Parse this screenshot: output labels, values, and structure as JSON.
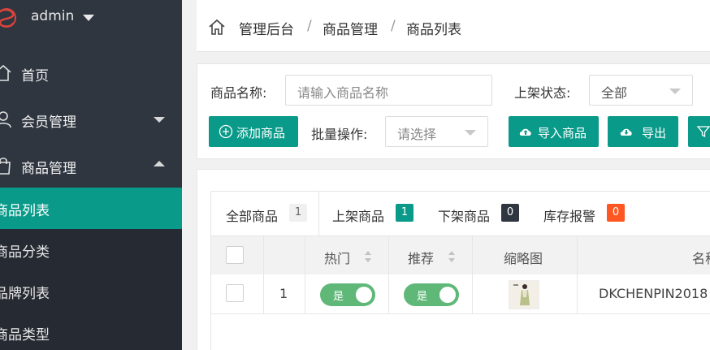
{
  "user": {
    "name": "admin"
  },
  "sidebar": {
    "items": [
      {
        "label": "首页",
        "icon": "home-icon"
      },
      {
        "label": "会员管理",
        "icon": "user-icon",
        "expanded": false
      },
      {
        "label": "商品管理",
        "icon": "shopping-bag-icon",
        "expanded": true
      }
    ],
    "submenu": [
      {
        "label": "商品列表",
        "active": true
      },
      {
        "label": "商品分类",
        "active": false
      },
      {
        "label": "品牌列表",
        "active": false
      },
      {
        "label": "商品类型",
        "active": false
      }
    ]
  },
  "breadcrumb": [
    "管理后台",
    "商品管理",
    "商品列表"
  ],
  "breadcrumb_separator": "/",
  "filters": {
    "name_label": "商品名称:",
    "name_placeholder": "请输入商品名称",
    "status_label": "上架状态:",
    "status_value": "全部",
    "batch_label": "批量操作:",
    "batch_placeholder": "请选择"
  },
  "toolbar": {
    "add_label": "添加商品",
    "import_label": "导入商品",
    "export_label": "导出"
  },
  "tabs": [
    {
      "label": "全部商品",
      "count": "1",
      "badge_color": "#f0f0f0"
    },
    {
      "label": "上架商品",
      "count": "1",
      "badge_color": "#0a9a89"
    },
    {
      "label": "下架商品",
      "count": "0",
      "badge_color": "#2f3640"
    },
    {
      "label": "库存报警",
      "count": "0",
      "badge_color": "#ff5722"
    }
  ],
  "table": {
    "headers": [
      "热门",
      "推荐",
      "缩略图",
      "名称"
    ],
    "rows": [
      {
        "index": "1",
        "hot": "是",
        "recommend": "是",
        "name": "DKCHENPIN2018"
      }
    ]
  },
  "colors": {
    "accent": "#0a9a89",
    "sidebar": "#2f3640",
    "switch_on": "#5fb878"
  }
}
